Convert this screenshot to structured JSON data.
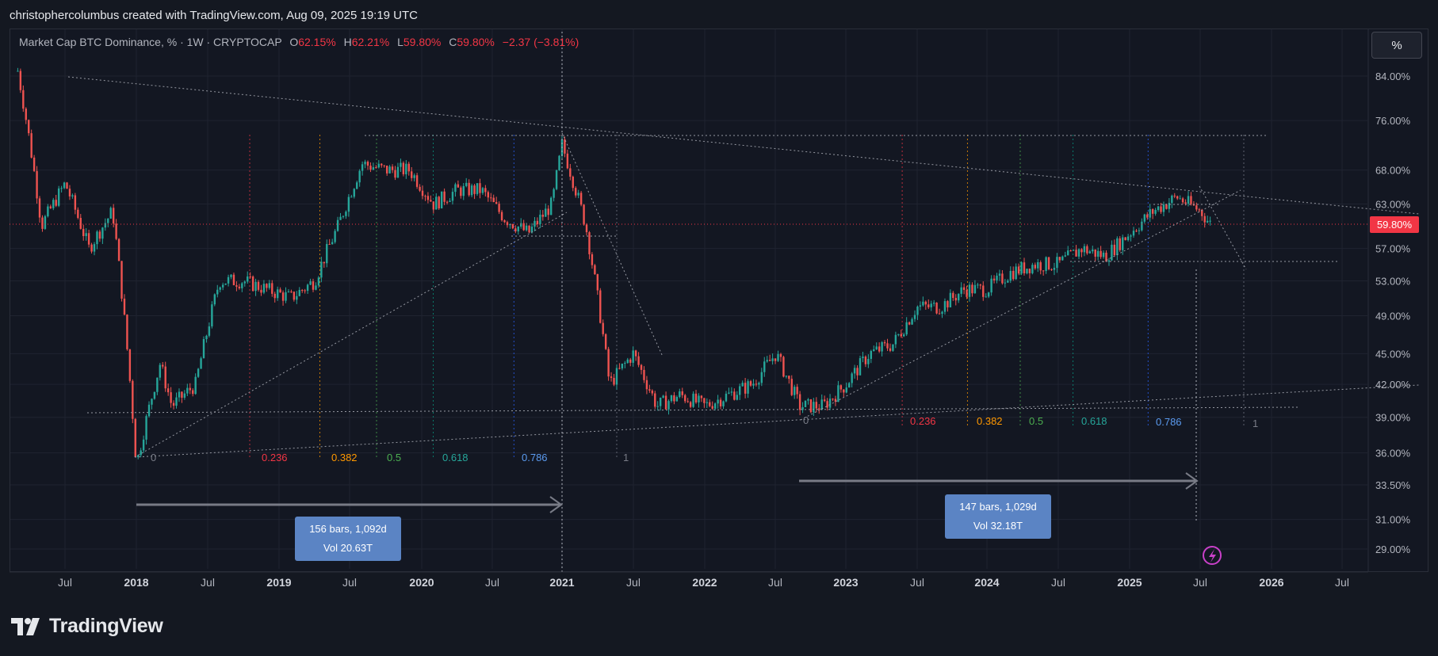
{
  "header": {
    "attribution": "christophercolumbus created with TradingView.com, Aug 09, 2025 19:19 UTC"
  },
  "legend": {
    "symbol": "Market Cap BTC Dominance, % · 1W · CRYPTOCAP",
    "o_label": "O",
    "o_value": "62.15%",
    "h_label": "H",
    "h_value": "62.21%",
    "l_label": "L",
    "l_value": "59.80%",
    "c_label": "C",
    "c_value": "59.80%",
    "change": "−2.37 (−3.81%)"
  },
  "scale_button": {
    "label": "%"
  },
  "footer": {
    "brand": "TradingView"
  },
  "colors": {
    "up": "#26a69a",
    "down": "#ef5350",
    "background": "#131722",
    "price_tag": "#f23645",
    "measure_box": "#5b84c4",
    "fib_0236": "#f23645",
    "fib_0382": "#ff9800",
    "fib_05": "#4caf50",
    "fib_0618": "#089981",
    "fib_0786": "#2962ff",
    "fib_1": "#787b86"
  },
  "chart_data": {
    "type": "candlestick",
    "title": "Market Cap BTC Dominance, % · 1W · CRYPTOCAP",
    "x_axis": {
      "labels": [
        "Jul",
        "2018",
        "Jul",
        "2019",
        "Jul",
        "2020",
        "Jul",
        "2021",
        "Jul",
        "2022",
        "Jul",
        "2023",
        "Jul",
        "2024",
        "Jul",
        "2025",
        "Jul",
        "2026",
        "Jul"
      ]
    },
    "y_axis": {
      "scale": "log",
      "range": [
        27.5,
        92
      ],
      "ticks": [
        "84.00%",
        "76.00%",
        "68.00%",
        "63.00%",
        "57.00%",
        "53.00%",
        "49.00%",
        "45.00%",
        "42.00%",
        "39.00%",
        "36.00%",
        "33.50%",
        "31.00%",
        "29.00%"
      ]
    },
    "last_price_label": "59.80%",
    "series": [
      {
        "points": [
          [
            "2017-03",
            85
          ],
          [
            "2017-05",
            60
          ],
          [
            "2017-07",
            66
          ],
          [
            "2017-09",
            57
          ],
          [
            "2017-11",
            62
          ],
          [
            "2018-01",
            35
          ],
          [
            "2018-03",
            44
          ],
          [
            "2018-04",
            40
          ],
          [
            "2018-06",
            42
          ],
          [
            "2018-08",
            53
          ],
          [
            "2018-10",
            53
          ],
          [
            "2018-12",
            52
          ],
          [
            "2019-02",
            51
          ],
          [
            "2019-04",
            53
          ],
          [
            "2019-06",
            60
          ],
          [
            "2019-08",
            69
          ],
          [
            "2019-10",
            68
          ],
          [
            "2019-12",
            68
          ],
          [
            "2020-02",
            63
          ],
          [
            "2020-04",
            65
          ],
          [
            "2020-06",
            65
          ],
          [
            "2020-08",
            61
          ],
          [
            "2020-10",
            59
          ],
          [
            "2020-12",
            63
          ],
          [
            "2021-01",
            72
          ],
          [
            "2021-03",
            60
          ],
          [
            "2021-05",
            42
          ],
          [
            "2021-07",
            45
          ],
          [
            "2021-09",
            40
          ],
          [
            "2021-11",
            41
          ],
          [
            "2022-01",
            40
          ],
          [
            "2022-03",
            41
          ],
          [
            "2022-05",
            42
          ],
          [
            "2022-07",
            45
          ],
          [
            "2022-09",
            40
          ],
          [
            "2022-11",
            40
          ],
          [
            "2023-01",
            42
          ],
          [
            "2023-03",
            45
          ],
          [
            "2023-05",
            46
          ],
          [
            "2023-07",
            50
          ],
          [
            "2023-09",
            50
          ],
          [
            "2023-11",
            52
          ],
          [
            "2024-01",
            52
          ],
          [
            "2024-03",
            54
          ],
          [
            "2024-05",
            55
          ],
          [
            "2024-07",
            55
          ],
          [
            "2024-09",
            57
          ],
          [
            "2024-11",
            56
          ],
          [
            "2025-01",
            59
          ],
          [
            "2025-03",
            62
          ],
          [
            "2025-05",
            64
          ],
          [
            "2025-07",
            62
          ],
          [
            "2025-08",
            59.8
          ]
        ]
      }
    ],
    "fib_labels": {
      "left": [
        "0",
        "0.236",
        "0.382",
        "0.5",
        "0.618",
        "0.786",
        "1"
      ],
      "right": [
        "0",
        "0.236",
        "0.382",
        "0.5",
        "0.618",
        "0.786",
        "1"
      ]
    },
    "measurements": [
      {
        "bars": "156 bars, 1,092d",
        "vol": "Vol 20.63T"
      },
      {
        "bars": "147 bars, 1,029d",
        "vol": "Vol 32.18T"
      }
    ]
  }
}
